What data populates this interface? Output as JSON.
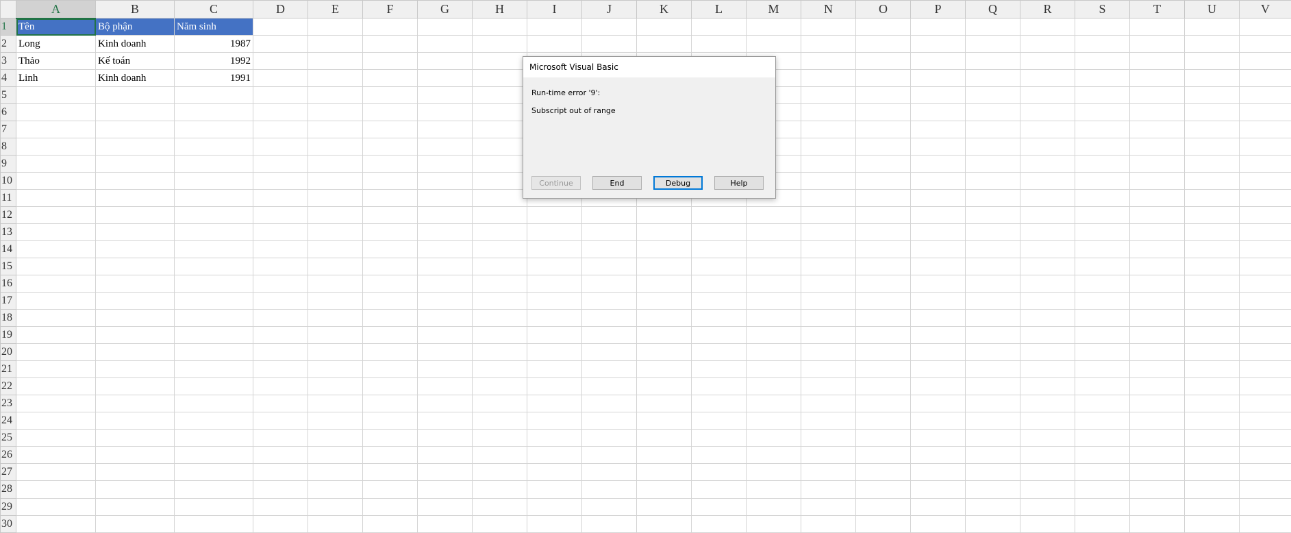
{
  "columns": [
    "A",
    "B",
    "C",
    "D",
    "E",
    "F",
    "G",
    "H",
    "I",
    "J",
    "K",
    "L",
    "M",
    "N",
    "O",
    "P",
    "Q",
    "R",
    "S",
    "T",
    "U",
    "V"
  ],
  "rows": [
    "1",
    "2",
    "3",
    "4",
    "5",
    "6",
    "7",
    "8",
    "9",
    "10",
    "11",
    "12",
    "13",
    "14",
    "15",
    "16",
    "17",
    "18",
    "19",
    "20",
    "21",
    "22",
    "23",
    "24",
    "25",
    "26",
    "27",
    "28",
    "29",
    "30"
  ],
  "cells": [
    [
      "Tên",
      "Bộ phận",
      "Năm sinh"
    ],
    [
      "Long",
      "Kinh doanh",
      "1987"
    ],
    [
      "Thảo",
      "Kế toán",
      "1992"
    ],
    [
      "Linh",
      "Kinh doanh",
      "1991"
    ]
  ],
  "header_fill": "#4472c4",
  "selection_color": "#217346",
  "dialog": {
    "title": "Microsoft Visual Basic",
    "error_line": "Run-time error '9':",
    "message": "Subscript out of range",
    "buttons": {
      "continue": "Continue",
      "end": "End",
      "debug": "Debug",
      "help": "Help"
    }
  }
}
